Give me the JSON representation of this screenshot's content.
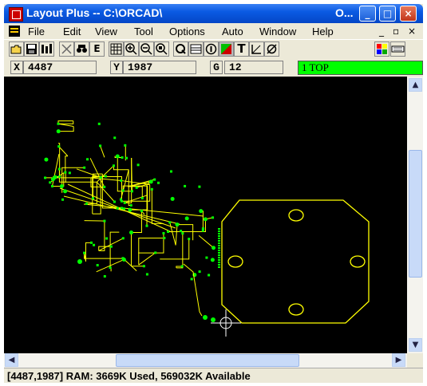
{
  "window": {
    "title": "Layout Plus -- C:\\ORCAD\\",
    "title_tail": "O...",
    "controls": [
      "_",
      "□",
      "×"
    ]
  },
  "menu": {
    "items": [
      "File",
      "Edit",
      "View",
      "Tool",
      "Options",
      "Auto",
      "Window",
      "Help"
    ],
    "mdi_controls": [
      "_",
      "▫",
      "×"
    ]
  },
  "toolbar": {
    "buttons": [
      "open-folder",
      "save",
      "library",
      "cross",
      "spyglass",
      "E",
      "grid",
      "zoom-in",
      "zoom-out",
      "zoom-all",
      "query",
      "spreadsheet",
      "info",
      "color",
      "T",
      "angle",
      "null",
      "palette",
      "drc"
    ],
    "e_label": "E",
    "t_label": "T"
  },
  "coords": {
    "x_label": "X",
    "x_value": "4487",
    "y_label": "Y",
    "y_value": "1987",
    "g_label": "G",
    "g_value": "12",
    "layer": "1 TOP"
  },
  "colors": {
    "canvas": "#000000",
    "traces": "#ffff00",
    "pads": "#00ff00",
    "layer_box": "#00ff00"
  },
  "status": {
    "text": "[4487,1987]   RAM: 3669K Used, 569032K Available"
  }
}
